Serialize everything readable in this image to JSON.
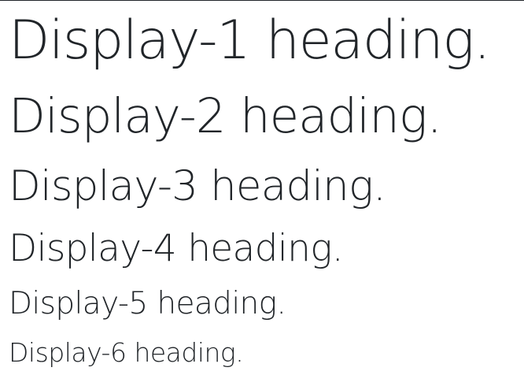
{
  "headings": [
    "Display-1 heading.",
    "Display-2 heading.",
    "Display-3 heading.",
    "Display-4 heading.",
    "Display-5 heading.",
    "Display-6 heading."
  ],
  "colors": {
    "text": "#212529",
    "background": "#ffffff"
  }
}
